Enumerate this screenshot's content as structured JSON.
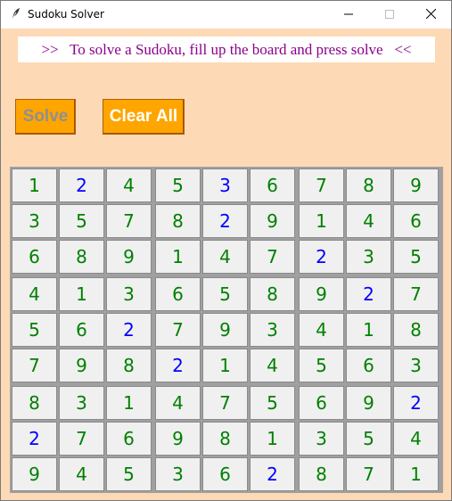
{
  "window": {
    "title": "Sudoku Solver",
    "icons": {
      "app": "feather-icon",
      "minimize": "minimize-icon",
      "maximize": "maximize-icon",
      "close": "close-icon"
    }
  },
  "banner": {
    "text": ">>   To solve a Sudoku, fill up the board and press solve   <<"
  },
  "buttons": {
    "solve_label": "Solve",
    "clear_label": "Clear All"
  },
  "colors": {
    "background": "#fdd9b5",
    "banner_text": "#8b008b",
    "button": "#ffa500",
    "solved_digit": "#008000",
    "given_digit": "#0000ff"
  },
  "board": {
    "values": [
      [
        "1",
        "2",
        "4",
        "5",
        "3",
        "6",
        "7",
        "8",
        "9"
      ],
      [
        "3",
        "5",
        "7",
        "8",
        "2",
        "9",
        "1",
        "4",
        "6"
      ],
      [
        "6",
        "8",
        "9",
        "1",
        "4",
        "7",
        "2",
        "3",
        "5"
      ],
      [
        "4",
        "1",
        "3",
        "6",
        "5",
        "8",
        "9",
        "2",
        "7"
      ],
      [
        "5",
        "6",
        "2",
        "7",
        "9",
        "3",
        "4",
        "1",
        "8"
      ],
      [
        "7",
        "9",
        "8",
        "2",
        "1",
        "4",
        "5",
        "6",
        "3"
      ],
      [
        "8",
        "3",
        "1",
        "4",
        "7",
        "5",
        "6",
        "9",
        "2"
      ],
      [
        "2",
        "7",
        "6",
        "9",
        "8",
        "1",
        "3",
        "5",
        "4"
      ],
      [
        "9",
        "4",
        "5",
        "3",
        "6",
        "2",
        "8",
        "7",
        "1"
      ]
    ],
    "given": [
      [
        0,
        1,
        0,
        0,
        1,
        0,
        0,
        0,
        0
      ],
      [
        0,
        0,
        0,
        0,
        1,
        0,
        0,
        0,
        0
      ],
      [
        0,
        0,
        0,
        0,
        0,
        0,
        1,
        0,
        0
      ],
      [
        0,
        0,
        0,
        0,
        0,
        0,
        0,
        1,
        0
      ],
      [
        0,
        0,
        1,
        0,
        0,
        0,
        0,
        0,
        0
      ],
      [
        0,
        0,
        0,
        1,
        0,
        0,
        0,
        0,
        0
      ],
      [
        0,
        0,
        0,
        0,
        0,
        0,
        0,
        0,
        1
      ],
      [
        1,
        0,
        0,
        0,
        0,
        0,
        0,
        0,
        0
      ],
      [
        0,
        0,
        0,
        0,
        0,
        1,
        0,
        0,
        0
      ]
    ]
  }
}
